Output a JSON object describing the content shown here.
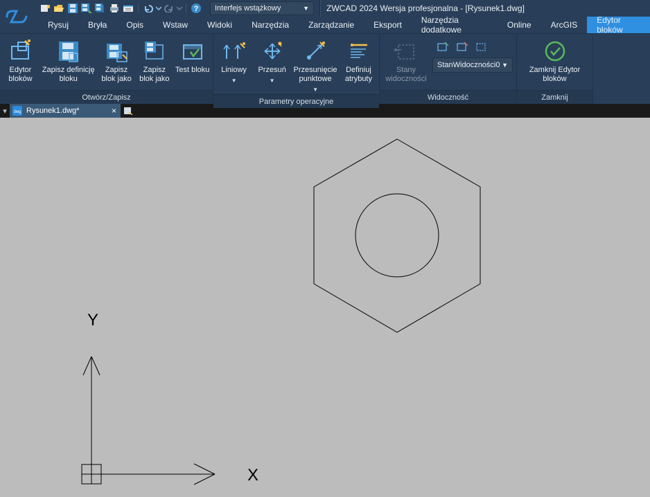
{
  "title": "ZWCAD 2024 Wersja profesjonalna - [Rysunek1.dwg]",
  "interface_combo": "Interfejs wstążkowy",
  "menus": [
    "Rysuj",
    "Bryła",
    "Opis",
    "Wstaw",
    "Widoki",
    "Narzędzia",
    "Zarządzanie",
    "Eksport",
    "Narzędzia dodatkowe",
    "Online",
    "ArcGIS",
    "Edytor bloków"
  ],
  "active_menu_index": 11,
  "ribbon": {
    "panels": [
      {
        "label": "Otwórz/Zapisz",
        "buttons": [
          {
            "key": "edytor-blokow",
            "label": "Edytor bloków"
          },
          {
            "key": "zapisz-definicje",
            "label": "Zapisz definicję bloku"
          },
          {
            "key": "zapisz-blok-jako",
            "label": "Zapisz blok jako"
          },
          {
            "key": "zapisz-blok-jako2",
            "label": "Zapisz blok jako"
          },
          {
            "key": "test-bloku",
            "label": "Test bloku"
          }
        ]
      },
      {
        "label": "Parametry operacyjne",
        "buttons": [
          {
            "key": "liniowy",
            "label": "Liniowy",
            "dropdown": true
          },
          {
            "key": "przesun",
            "label": "Przesuń",
            "dropdown": true
          },
          {
            "key": "przesuniecie-punktowe",
            "label": "Przesunięcie punktowe",
            "dropdown": true
          },
          {
            "key": "definiuj-atrybuty",
            "label": "Definiuj atrybuty"
          }
        ]
      },
      {
        "label": "Widoczność",
        "buttons": [
          {
            "key": "stany-widocznosci",
            "label": "Stany widoczności",
            "disabled": true
          }
        ],
        "combo": "StanWidoczności0"
      },
      {
        "label": "Zamknij",
        "buttons": [
          {
            "key": "zamknij-edytor",
            "label": "Zamknij Edytor bloków"
          }
        ]
      }
    ]
  },
  "doc_tab": "Rysunek1.dwg*",
  "axis": {
    "x": "X",
    "y": "Y"
  }
}
